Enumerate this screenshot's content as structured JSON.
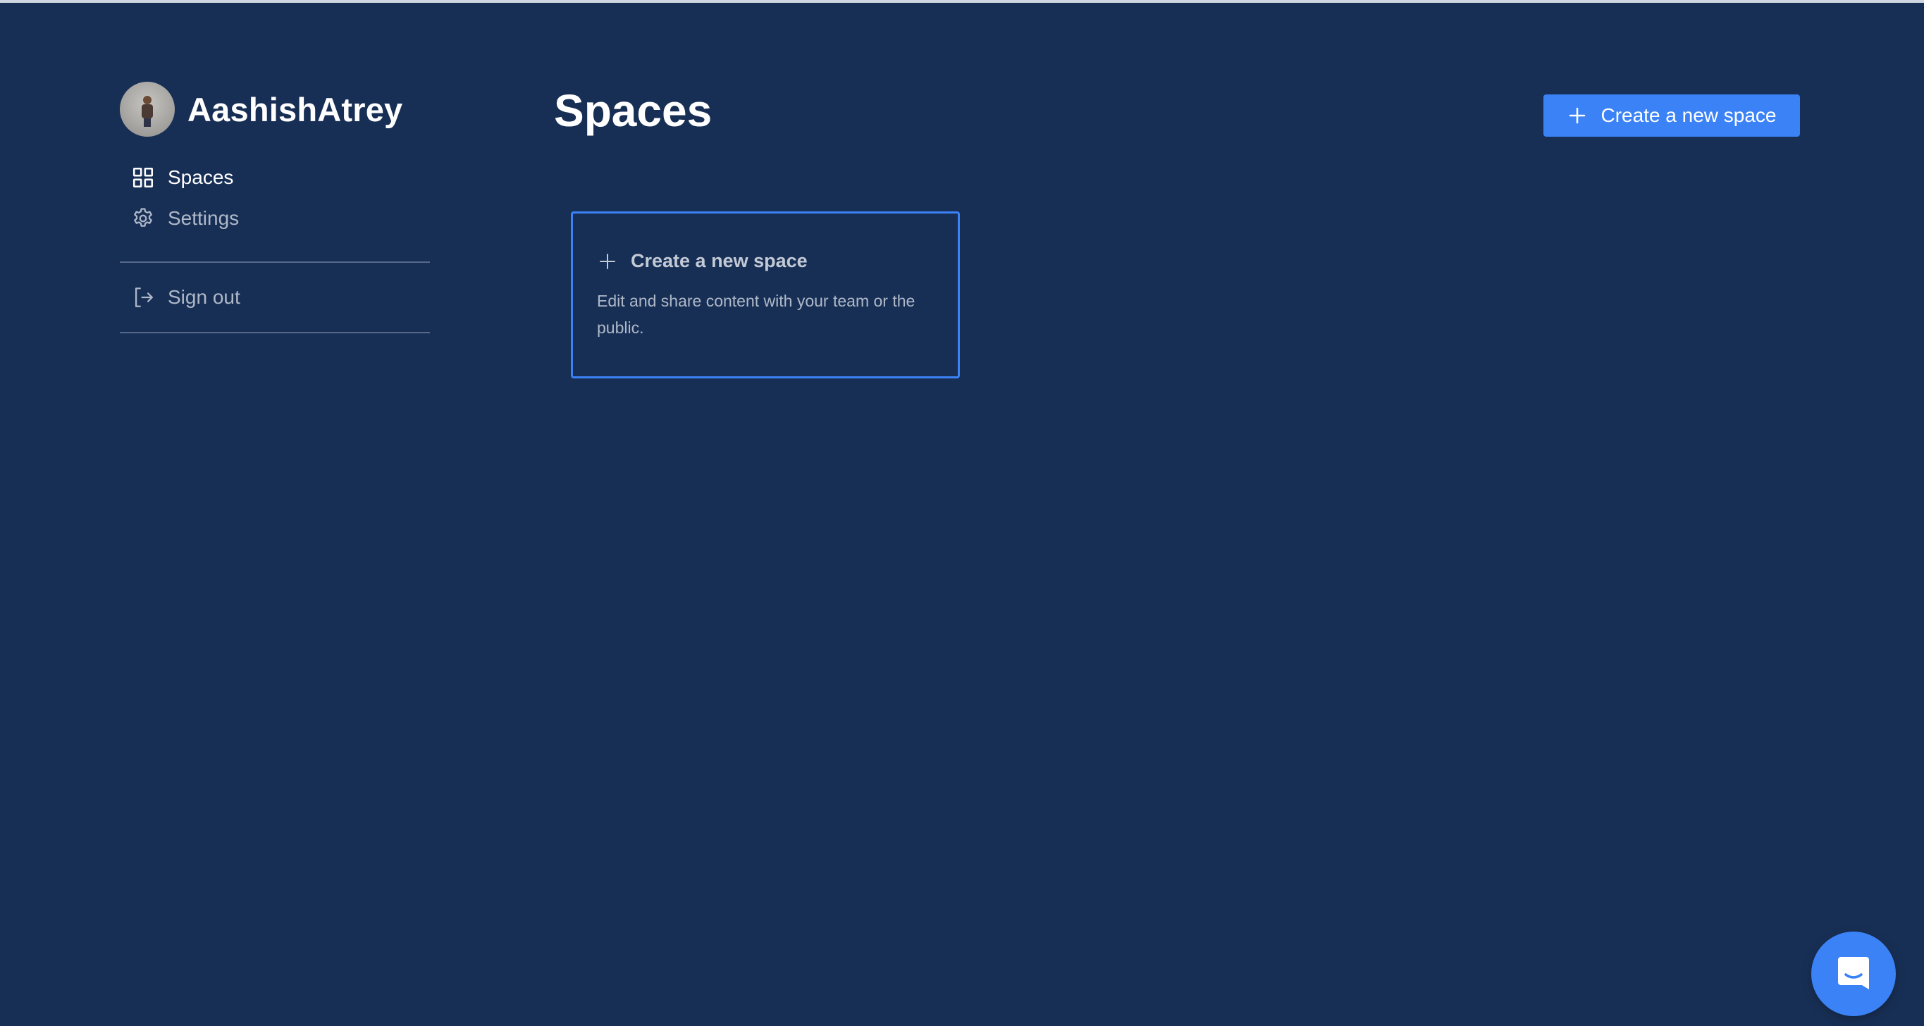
{
  "user": {
    "name": "AashishAtrey"
  },
  "sidebar": {
    "items": [
      {
        "label": "Spaces",
        "icon": "grid-icon",
        "active": true
      },
      {
        "label": "Settings",
        "icon": "gear-icon",
        "active": false
      }
    ],
    "sign_out": {
      "label": "Sign out",
      "icon": "sign-out-icon"
    }
  },
  "main": {
    "title": "Spaces",
    "create_button_label": "Create a new space",
    "card": {
      "title": "Create a new space",
      "description": "Edit and share content with your team or the public."
    }
  },
  "colors": {
    "background": "#182f55",
    "accent": "#3b82f6",
    "muted_text": "#aeb8c8",
    "divider": "#56698a"
  },
  "chat_launcher": {
    "icon": "chat-icon"
  }
}
